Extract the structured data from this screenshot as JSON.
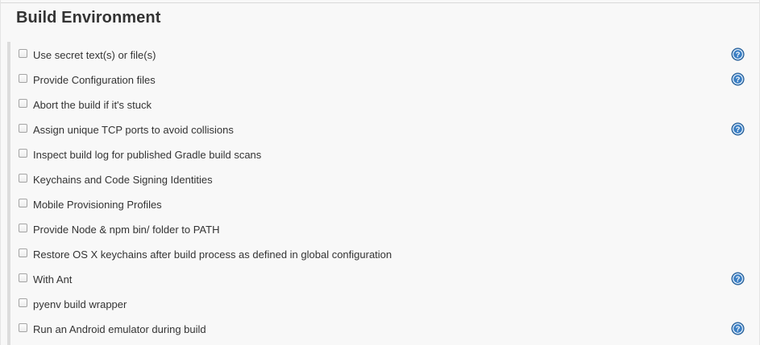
{
  "section": {
    "title": "Build Environment"
  },
  "options": [
    {
      "label": "Use secret text(s) or file(s)",
      "checked": false,
      "help": true
    },
    {
      "label": "Provide Configuration files",
      "checked": false,
      "help": true
    },
    {
      "label": "Abort the build if it's stuck",
      "checked": false,
      "help": false
    },
    {
      "label": "Assign unique TCP ports to avoid collisions",
      "checked": false,
      "help": true
    },
    {
      "label": "Inspect build log for published Gradle build scans",
      "checked": false,
      "help": false
    },
    {
      "label": "Keychains and Code Signing Identities",
      "checked": false,
      "help": false
    },
    {
      "label": "Mobile Provisioning Profiles",
      "checked": false,
      "help": false
    },
    {
      "label": "Provide Node & npm bin/ folder to PATH",
      "checked": false,
      "help": false
    },
    {
      "label": "Restore OS X keychains after build process as defined in global configuration",
      "checked": false,
      "help": false
    },
    {
      "label": "With Ant",
      "checked": false,
      "help": true
    },
    {
      "label": "pyenv build wrapper",
      "checked": false,
      "help": false
    },
    {
      "label": "Run an Android emulator during build",
      "checked": false,
      "help": true
    }
  ],
  "colors": {
    "help_icon_fill": "#3b7fc4",
    "text": "#333333"
  }
}
